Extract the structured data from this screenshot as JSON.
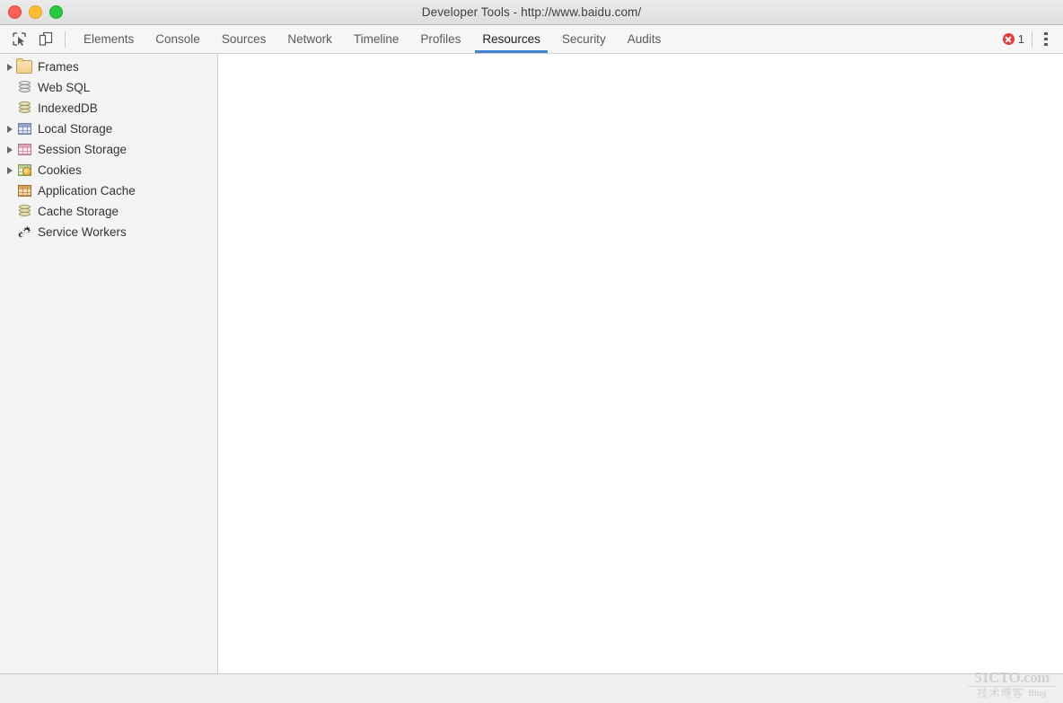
{
  "window": {
    "title": "Developer Tools - http://www.baidu.com/",
    "traffic_lights": [
      {
        "name": "close",
        "color": "#ff5f57"
      },
      {
        "name": "minimize",
        "color": "#ffbd2e"
      },
      {
        "name": "maximize",
        "color": "#28c840"
      }
    ]
  },
  "toolbar": {
    "inspect_icon": "inspect-element-icon",
    "device_icon": "device-toolbar-icon",
    "tabs": [
      {
        "label": "Elements",
        "active": false
      },
      {
        "label": "Console",
        "active": false
      },
      {
        "label": "Sources",
        "active": false
      },
      {
        "label": "Network",
        "active": false
      },
      {
        "label": "Timeline",
        "active": false
      },
      {
        "label": "Profiles",
        "active": false
      },
      {
        "label": "Resources",
        "active": true
      },
      {
        "label": "Security",
        "active": false
      },
      {
        "label": "Audits",
        "active": false
      }
    ],
    "active_tab": "Resources",
    "active_underline_color": "#4285d6",
    "error_icon": "error-circle-icon",
    "error_count": "1",
    "error_color": "#e53935",
    "menu_icon": "more-vertical-icon"
  },
  "sidebar": {
    "items": [
      {
        "label": "Frames",
        "icon": "folder-icon",
        "expandable": true
      },
      {
        "label": "Web SQL",
        "icon": "database-gray-icon",
        "expandable": false
      },
      {
        "label": "IndexedDB",
        "icon": "database-olive-icon",
        "expandable": false
      },
      {
        "label": "Local Storage",
        "icon": "table-blue-icon",
        "expandable": true
      },
      {
        "label": "Session Storage",
        "icon": "table-pink-icon",
        "expandable": true
      },
      {
        "label": "Cookies",
        "icon": "cookie-table-icon",
        "expandable": true
      },
      {
        "label": "Application Cache",
        "icon": "table-orange-icon",
        "expandable": false
      },
      {
        "label": "Cache Storage",
        "icon": "database-olive-icon",
        "expandable": false
      },
      {
        "label": "Service Workers",
        "icon": "gears-icon",
        "expandable": false
      }
    ]
  },
  "content": {
    "empty": ""
  },
  "watermark": {
    "site": "51CTO.com",
    "tagline": "技术博客",
    "blog": "Blog"
  }
}
